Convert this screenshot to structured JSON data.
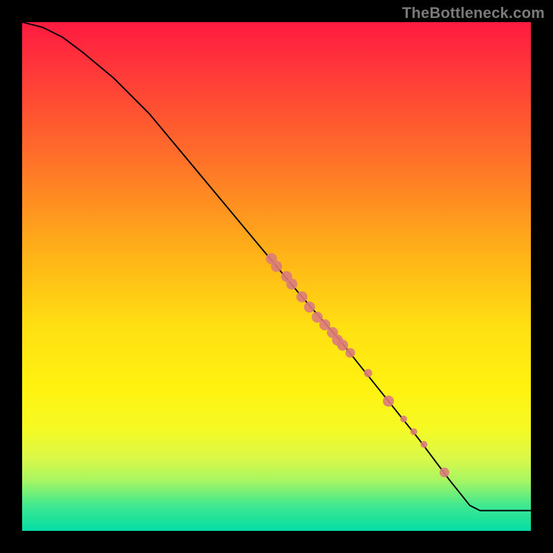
{
  "watermark": {
    "text": "TheBottleneck.com"
  },
  "chart_data": {
    "type": "line",
    "title": "",
    "xlabel": "",
    "ylabel": "",
    "xlim": [
      0,
      100
    ],
    "ylim": [
      0,
      100
    ],
    "grid": false,
    "legend": false,
    "series": [
      {
        "name": "curve",
        "x": [
          0,
          4,
          8,
          12,
          18,
          25,
          35,
          45,
          55,
          62,
          70,
          78,
          84,
          88,
          90,
          100
        ],
        "y": [
          100,
          99,
          97,
          94,
          89,
          82,
          70,
          58,
          46,
          38,
          28,
          18,
          10,
          5,
          4,
          4
        ],
        "stroke": "#000000",
        "stroke_width": 2
      }
    ],
    "scatter": {
      "name": "markers",
      "color": "#db7b7b",
      "points": [
        {
          "x": 49.0,
          "y": 53.5,
          "r": 8
        },
        {
          "x": 50.0,
          "y": 52.0,
          "r": 8
        },
        {
          "x": 52.0,
          "y": 50.0,
          "r": 8
        },
        {
          "x": 53.0,
          "y": 48.5,
          "r": 8
        },
        {
          "x": 55.0,
          "y": 46.0,
          "r": 8
        },
        {
          "x": 56.5,
          "y": 44.0,
          "r": 8
        },
        {
          "x": 58.0,
          "y": 42.0,
          "r": 8
        },
        {
          "x": 59.5,
          "y": 40.5,
          "r": 8
        },
        {
          "x": 61.0,
          "y": 39.0,
          "r": 8
        },
        {
          "x": 62.0,
          "y": 37.5,
          "r": 8
        },
        {
          "x": 63.0,
          "y": 36.5,
          "r": 8
        },
        {
          "x": 64.5,
          "y": 35.0,
          "r": 7
        },
        {
          "x": 68.0,
          "y": 31.0,
          "r": 6
        },
        {
          "x": 72.0,
          "y": 25.5,
          "r": 8
        },
        {
          "x": 75.0,
          "y": 22.0,
          "r": 5
        },
        {
          "x": 77.0,
          "y": 19.5,
          "r": 5
        },
        {
          "x": 79.0,
          "y": 17.0,
          "r": 5
        },
        {
          "x": 83.0,
          "y": 11.5,
          "r": 7
        }
      ]
    }
  }
}
